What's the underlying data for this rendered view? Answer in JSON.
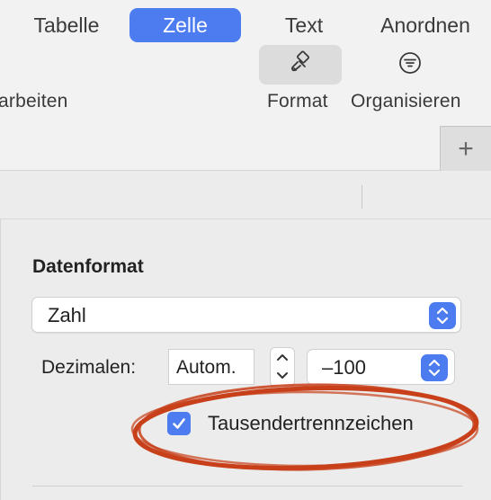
{
  "toolbar": {
    "bearbeiten_label": "arbeiten",
    "format_label": "Format",
    "organisieren_label": "Organisieren",
    "add_label": "+"
  },
  "tabs": [
    {
      "label": "Tabelle",
      "selected": false
    },
    {
      "label": "Zelle",
      "selected": true
    },
    {
      "label": "Text",
      "selected": false
    },
    {
      "label": "Anordnen",
      "selected": false
    }
  ],
  "inspector": {
    "section_title": "Datenformat",
    "format_popup": {
      "value": "Zahl"
    },
    "decimals": {
      "label": "Dezimalen:",
      "value": "Autom."
    },
    "negative_popup": {
      "value": "–100"
    },
    "thousands_separator": {
      "label": "Tausendertrennzeichen",
      "checked": true
    }
  },
  "colors": {
    "accent": "#4c7cf0",
    "annotation": "#c8401a"
  },
  "icons": {
    "format": "paintbrush-icon",
    "organize": "filter-lines-icon",
    "popup_arrows": "chevron-up-down-icon"
  }
}
